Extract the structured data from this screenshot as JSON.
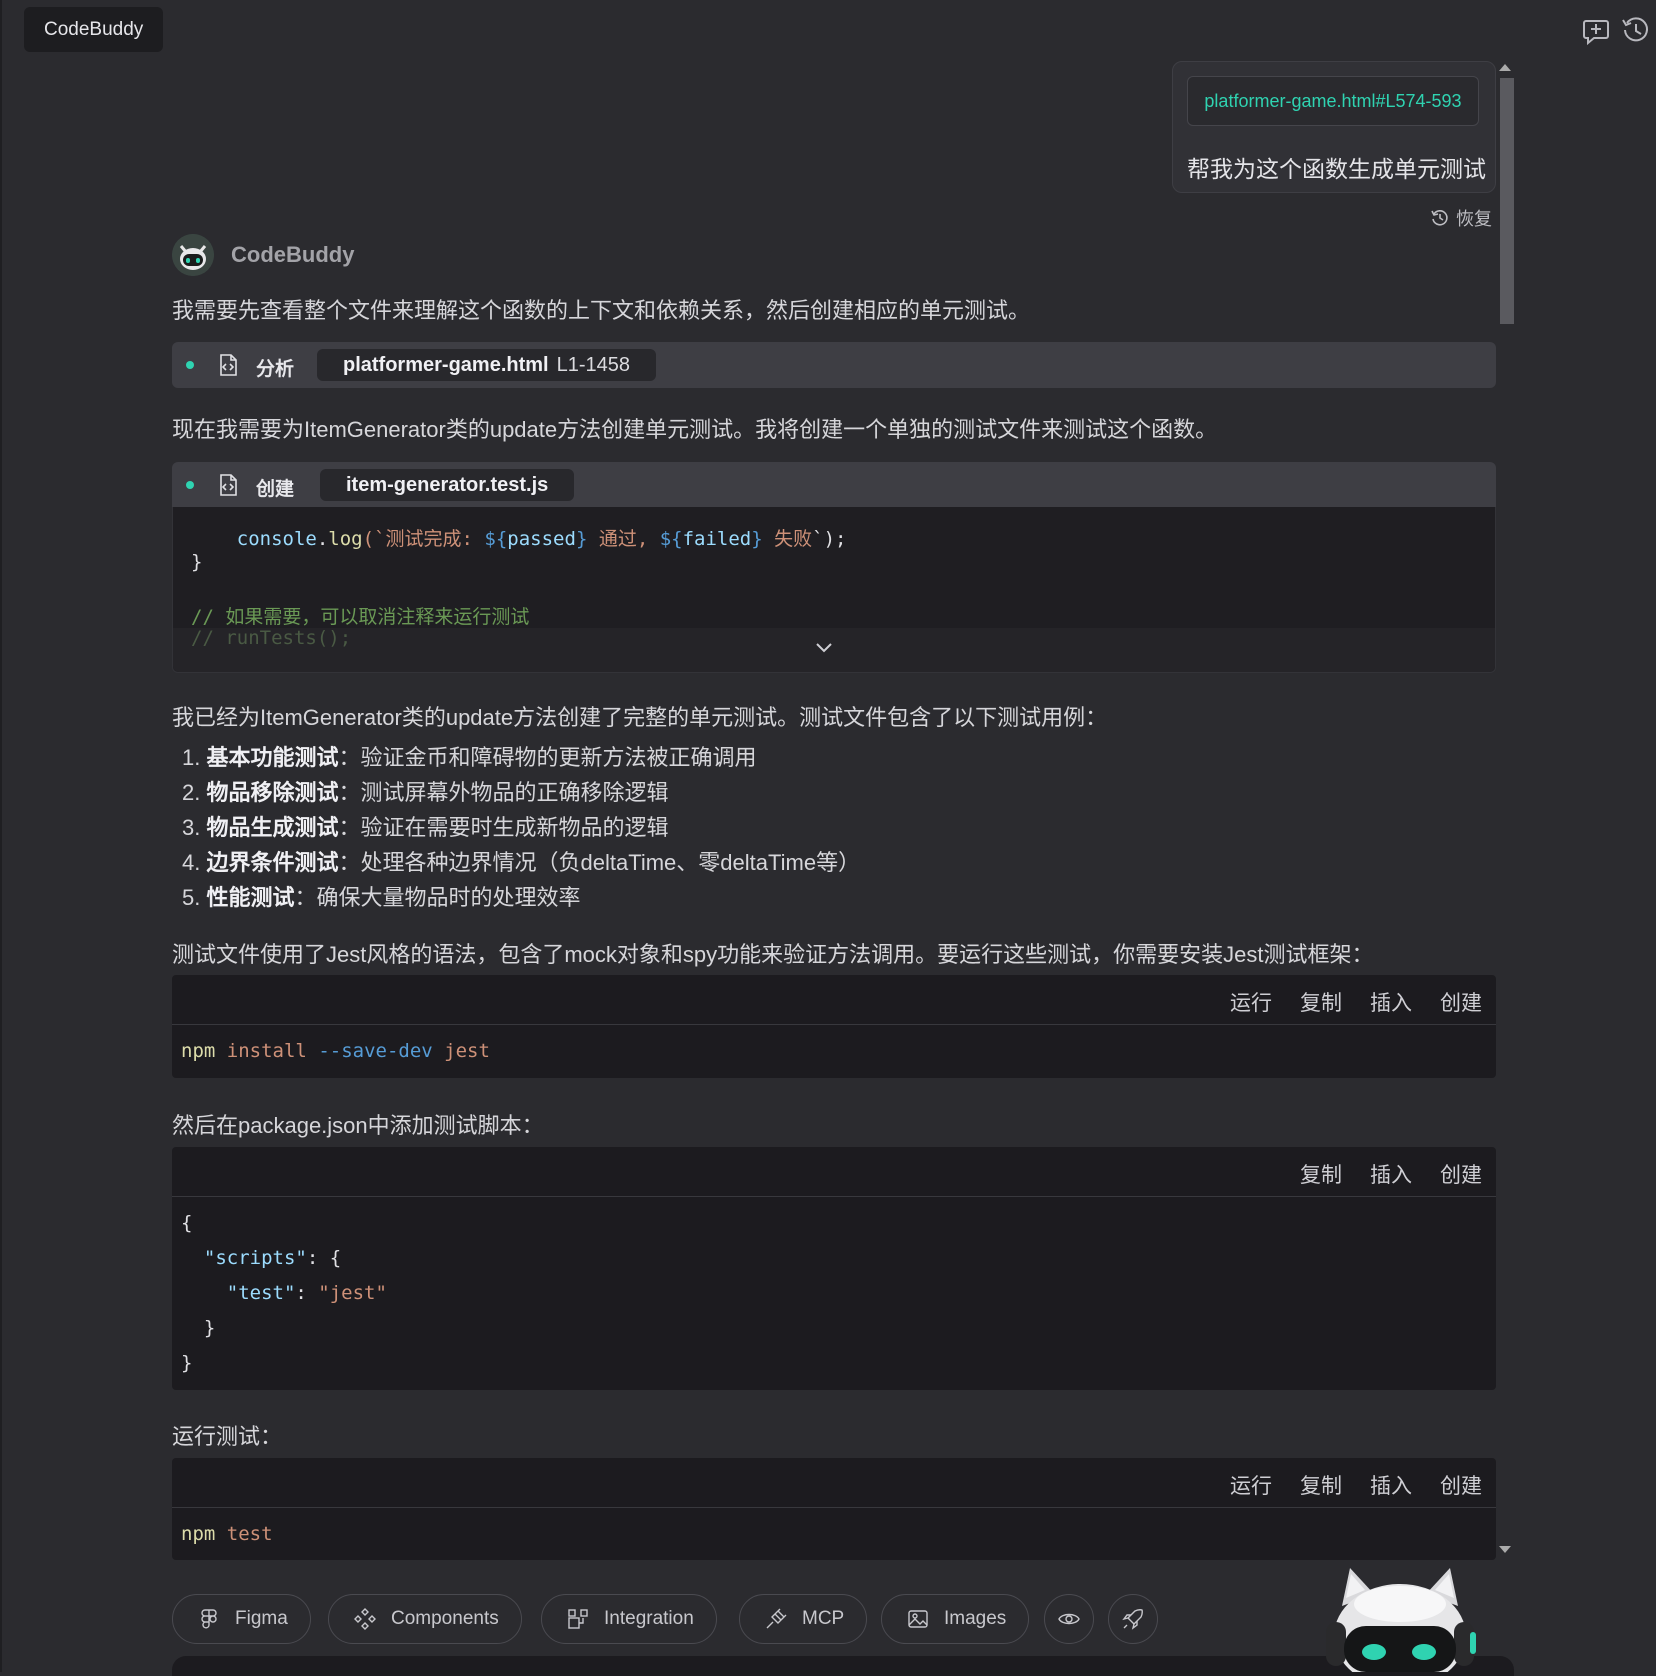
{
  "window": {
    "tab_title": "CodeBuddy"
  },
  "toolbar": {
    "icons": [
      "add-chat-icon",
      "history-icon"
    ]
  },
  "user_message": {
    "file_ref": "platformer-game.html#L574-593",
    "text": "帮我为这个函数生成单元测试",
    "restore_label": "恢复"
  },
  "assistant": {
    "name": "CodeBuddy",
    "intro": "我需要先查看整个文件来理解这个函数的上下文和依赖关系，然后创建相应的单元测试。",
    "tool_analyze": {
      "action": "分析",
      "file": "platformer-game.html",
      "range": "L1-1458"
    },
    "para_2": "现在我需要为ItemGenerator类的update方法创建单元测试。我将创建一个单独的测试文件来测试这个函数。",
    "tool_create": {
      "action": "创建",
      "file": "item-generator.test.js"
    },
    "preview": {
      "line1": {
        "indent": "    ",
        "obj": "console",
        "dot": ".",
        "fn": "log",
        "open": "(`",
        "s1": "测试完成: ",
        "v1o": "${",
        "v1": "passed",
        "v1c": "}",
        "s2": " 通过, ",
        "v2o": "${",
        "v2": "failed",
        "v2c": "}",
        "s3": " 失败",
        "close": "`);"
      },
      "line2": "}",
      "line3": "// 如果需要，可以取消注释来运行测试",
      "line4": "// runTests();"
    },
    "para_3": "我已经为ItemGenerator类的update方法创建了完整的单元测试。测试文件包含了以下测试用例：",
    "test_cases": [
      {
        "num": "1.",
        "title": "基本功能测试",
        "sep": "：",
        "desc": "验证金币和障碍物的更新方法被正确调用"
      },
      {
        "num": "2.",
        "title": "物品移除测试",
        "sep": "：",
        "desc": "测试屏幕外物品的正确移除逻辑"
      },
      {
        "num": "3.",
        "title": "物品生成测试",
        "sep": "：",
        "desc": "验证在需要时生成新物品的逻辑"
      },
      {
        "num": "4.",
        "title": "边界条件测试",
        "sep": "：",
        "desc": "处理各种边界情况（负deltaTime、零deltaTime等）"
      },
      {
        "num": "5.",
        "title": "性能测试",
        "sep": "：",
        "desc": "确保大量物品时的处理效率"
      }
    ],
    "para_4": "测试文件使用了Jest风格的语法，包含了mock对象和spy功能来验证方法调用。要运行这些测试，你需要安装Jest测试框架：",
    "para_5": "然后在package.json中添加测试脚本：",
    "para_6": "运行测试："
  },
  "code_actions": {
    "run": "运行",
    "copy": "复制",
    "insert": "插入",
    "create": "创建"
  },
  "code_install": {
    "cmd": "npm",
    "sub": "install",
    "flag": "--save-dev",
    "pkg": "jest"
  },
  "code_json": {
    "l1": "{",
    "l2_indent": "  ",
    "l2_key": "\"scripts\"",
    "l2_rest": ": {",
    "l3_indent": "    ",
    "l3_key": "\"test\"",
    "l3_colon": ": ",
    "l3_val": "\"jest\"",
    "l4": "  }",
    "l5": "}"
  },
  "code_test": {
    "cmd": "npm",
    "sub": "test"
  },
  "bottom_chips": [
    {
      "label": "Figma",
      "icon": "figma-icon"
    },
    {
      "label": "Components",
      "icon": "components-icon"
    },
    {
      "label": "Integration",
      "icon": "integration-icon"
    },
    {
      "label": "MCP",
      "icon": "plug-icon"
    },
    {
      "label": "Images",
      "icon": "image-icon"
    }
  ],
  "colors": {
    "accent": "#2fd3b1",
    "background": "#2b2b2f",
    "code_bg": "#1c1b1f"
  }
}
